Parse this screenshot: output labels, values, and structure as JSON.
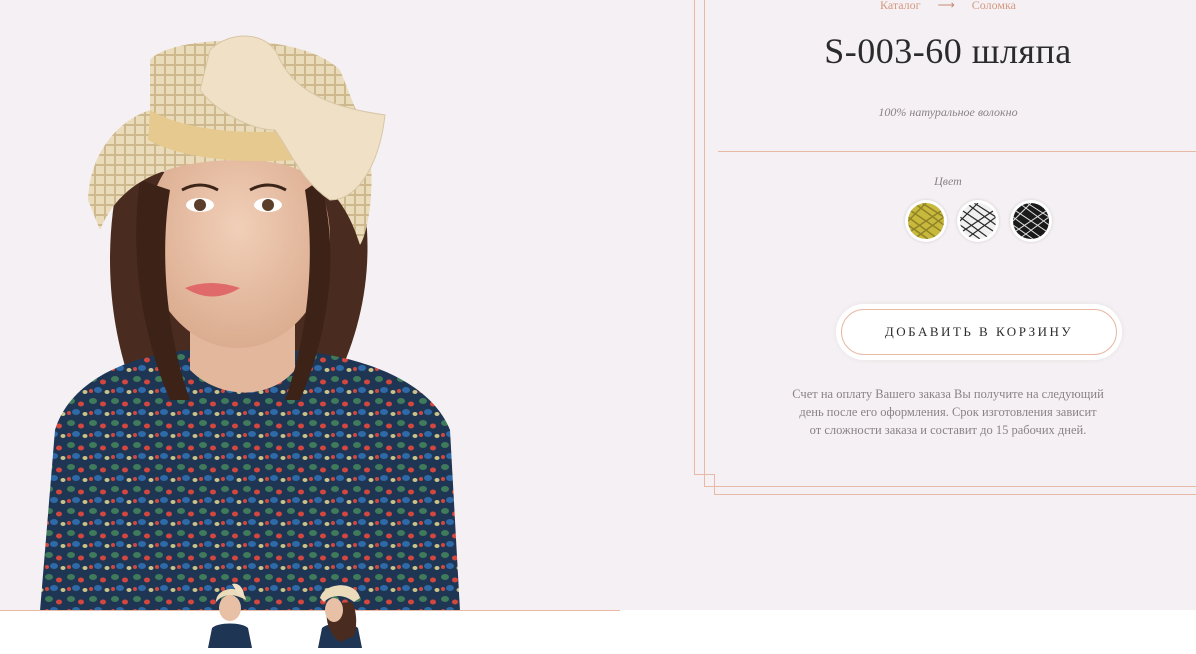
{
  "breadcrumb": {
    "items": [
      "Каталог",
      "Соломка"
    ],
    "separator": "⟶"
  },
  "product": {
    "title": "S-003-60 шляпа",
    "material": "100% натуральное волокно"
  },
  "colors": {
    "label": "Цвет",
    "swatches": [
      {
        "name": "yellow-straw",
        "color": "#c8b83c"
      },
      {
        "name": "white-black-straw",
        "color": "#e8e8e8"
      },
      {
        "name": "black-straw",
        "color": "#1a1a1a"
      }
    ]
  },
  "cart": {
    "button_label": "ДОБАВИТЬ В КОРЗИНУ"
  },
  "note": {
    "lines": [
      "Счет на оплату Вашего заказа Вы получите на следующий",
      "день после его оформления. Срок изготовления зависит",
      "от сложности заказа и составит до 15 рабочих дней."
    ]
  },
  "accent_color": "#e8b9a5",
  "background_color": "#f5f0f3"
}
